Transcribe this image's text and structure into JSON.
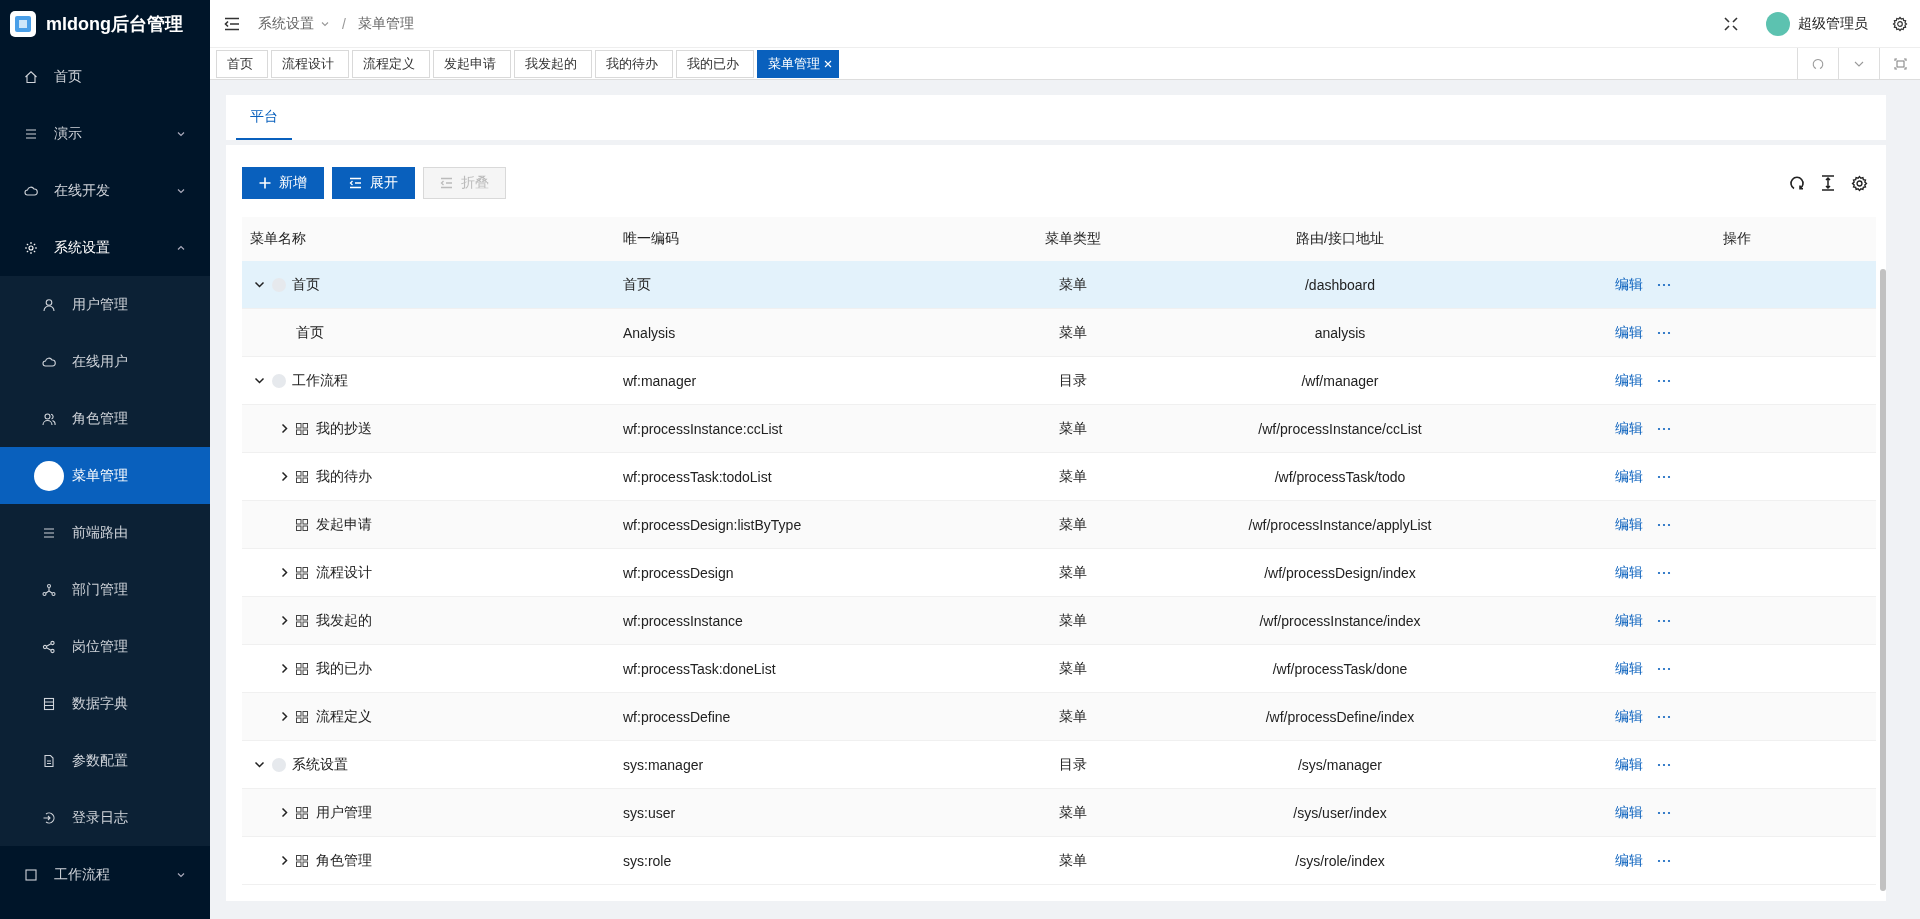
{
  "app": {
    "title": "mldong后台管理"
  },
  "sidebar": {
    "items": [
      {
        "label": "首页",
        "selected": false
      },
      {
        "label": "演示",
        "selected": false,
        "expanded": false
      },
      {
        "label": "在线开发",
        "selected": false,
        "expanded": false
      },
      {
        "label": "系统设置",
        "selected": false,
        "expanded": true,
        "children": [
          {
            "label": "用户管理",
            "selected": false
          },
          {
            "label": "在线用户",
            "selected": false
          },
          {
            "label": "角色管理",
            "selected": false
          },
          {
            "label": "菜单管理",
            "selected": true
          },
          {
            "label": "前端路由",
            "selected": false
          },
          {
            "label": "部门管理",
            "selected": false
          },
          {
            "label": "岗位管理",
            "selected": false
          },
          {
            "label": "数据字典",
            "selected": false
          },
          {
            "label": "参数配置",
            "selected": false
          },
          {
            "label": "登录日志",
            "selected": false
          }
        ]
      },
      {
        "label": "工作流程",
        "selected": false,
        "expanded": false
      }
    ]
  },
  "header": {
    "breadcrumb": [
      "系统设置",
      "菜单管理"
    ],
    "separator": "/",
    "user": "超级管理员"
  },
  "tabs": [
    {
      "label": "首页",
      "selected": false
    },
    {
      "label": "流程设计",
      "selected": false
    },
    {
      "label": "流程定义",
      "selected": false
    },
    {
      "label": "发起申请",
      "selected": false
    },
    {
      "label": "我发起的",
      "selected": false
    },
    {
      "label": "我的待办",
      "selected": false
    },
    {
      "label": "我的已办",
      "selected": false
    },
    {
      "label": "菜单管理",
      "selected": true
    }
  ],
  "panel_tabs": [
    {
      "label": "平台",
      "selected": true
    }
  ],
  "toolbar": [
    {
      "label": "新增",
      "kind": "add",
      "disabled": false
    },
    {
      "label": "展开",
      "kind": "expand",
      "disabled": false
    },
    {
      "label": "折叠",
      "kind": "collapse",
      "disabled": true
    }
  ],
  "table": {
    "columns": [
      "菜单名称",
      "唯一编码",
      "菜单类型",
      "路由/接口地址",
      "操作"
    ],
    "rows": [
      {
        "name": "首页",
        "code": "首页",
        "type": "菜单",
        "route": "/dashboard",
        "action": "编辑",
        "selected": true,
        "expandable": true,
        "expanded": true,
        "has_icon": true,
        "children": [
          {
            "name": "首页",
            "code": "Analysis",
            "type": "菜单",
            "route": "analysis",
            "action": "编辑",
            "selected": false,
            "has_icon": false
          }
        ]
      },
      {
        "name": "工作流程",
        "code": "wf:manager",
        "type": "目录",
        "route": "/wf/manager",
        "action": "编辑",
        "selected": false,
        "expandable": true,
        "expanded": true,
        "has_icon": true,
        "children": [
          {
            "name": "我的抄送",
            "code": "wf:processInstance:ccList",
            "type": "菜单",
            "route": "/wf/processInstance/ccList",
            "action": "编辑",
            "selected": false,
            "expandable": true,
            "expanded": false,
            "has_icon": true
          },
          {
            "name": "我的待办",
            "code": "wf:processTask:todoList",
            "type": "菜单",
            "route": "/wf/processTask/todo",
            "action": "编辑",
            "selected": false,
            "expandable": true,
            "expanded": false,
            "has_icon": true
          },
          {
            "name": "发起申请",
            "code": "wf:processDesign:listByType",
            "type": "菜单",
            "route": "/wf/processInstance/applyList",
            "action": "编辑",
            "selected": false,
            "has_icon": true
          },
          {
            "name": "流程设计",
            "code": "wf:processDesign",
            "type": "菜单",
            "route": "/wf/processDesign/index",
            "action": "编辑",
            "selected": false,
            "expandable": true,
            "expanded": false,
            "has_icon": true
          },
          {
            "name": "我发起的",
            "code": "wf:processInstance",
            "type": "菜单",
            "route": "/wf/processInstance/index",
            "action": "编辑",
            "selected": false,
            "expandable": true,
            "expanded": false,
            "has_icon": true
          },
          {
            "name": "我的已办",
            "code": "wf:processTask:doneList",
            "type": "菜单",
            "route": "/wf/processTask/done",
            "action": "编辑",
            "selected": false,
            "expandable": true,
            "expanded": false,
            "has_icon": true
          },
          {
            "name": "流程定义",
            "code": "wf:processDefine",
            "type": "菜单",
            "route": "/wf/processDefine/index",
            "action": "编辑",
            "selected": false,
            "expandable": true,
            "expanded": false,
            "has_icon": true
          }
        ]
      },
      {
        "name": "系统设置",
        "code": "sys:manager",
        "type": "目录",
        "route": "/sys/manager",
        "action": "编辑",
        "selected": false,
        "expandable": true,
        "expanded": true,
        "has_icon": true,
        "children": [
          {
            "name": "用户管理",
            "code": "sys:user",
            "type": "菜单",
            "route": "/sys/user/index",
            "action": "编辑",
            "selected": false,
            "expandable": true,
            "expanded": false,
            "has_icon": true
          },
          {
            "name": "角色管理",
            "code": "sys:role",
            "type": "菜单",
            "route": "/sys/role/index",
            "action": "编辑",
            "selected": false,
            "expandable": true,
            "expanded": false,
            "has_icon": true
          }
        ]
      }
    ]
  }
}
